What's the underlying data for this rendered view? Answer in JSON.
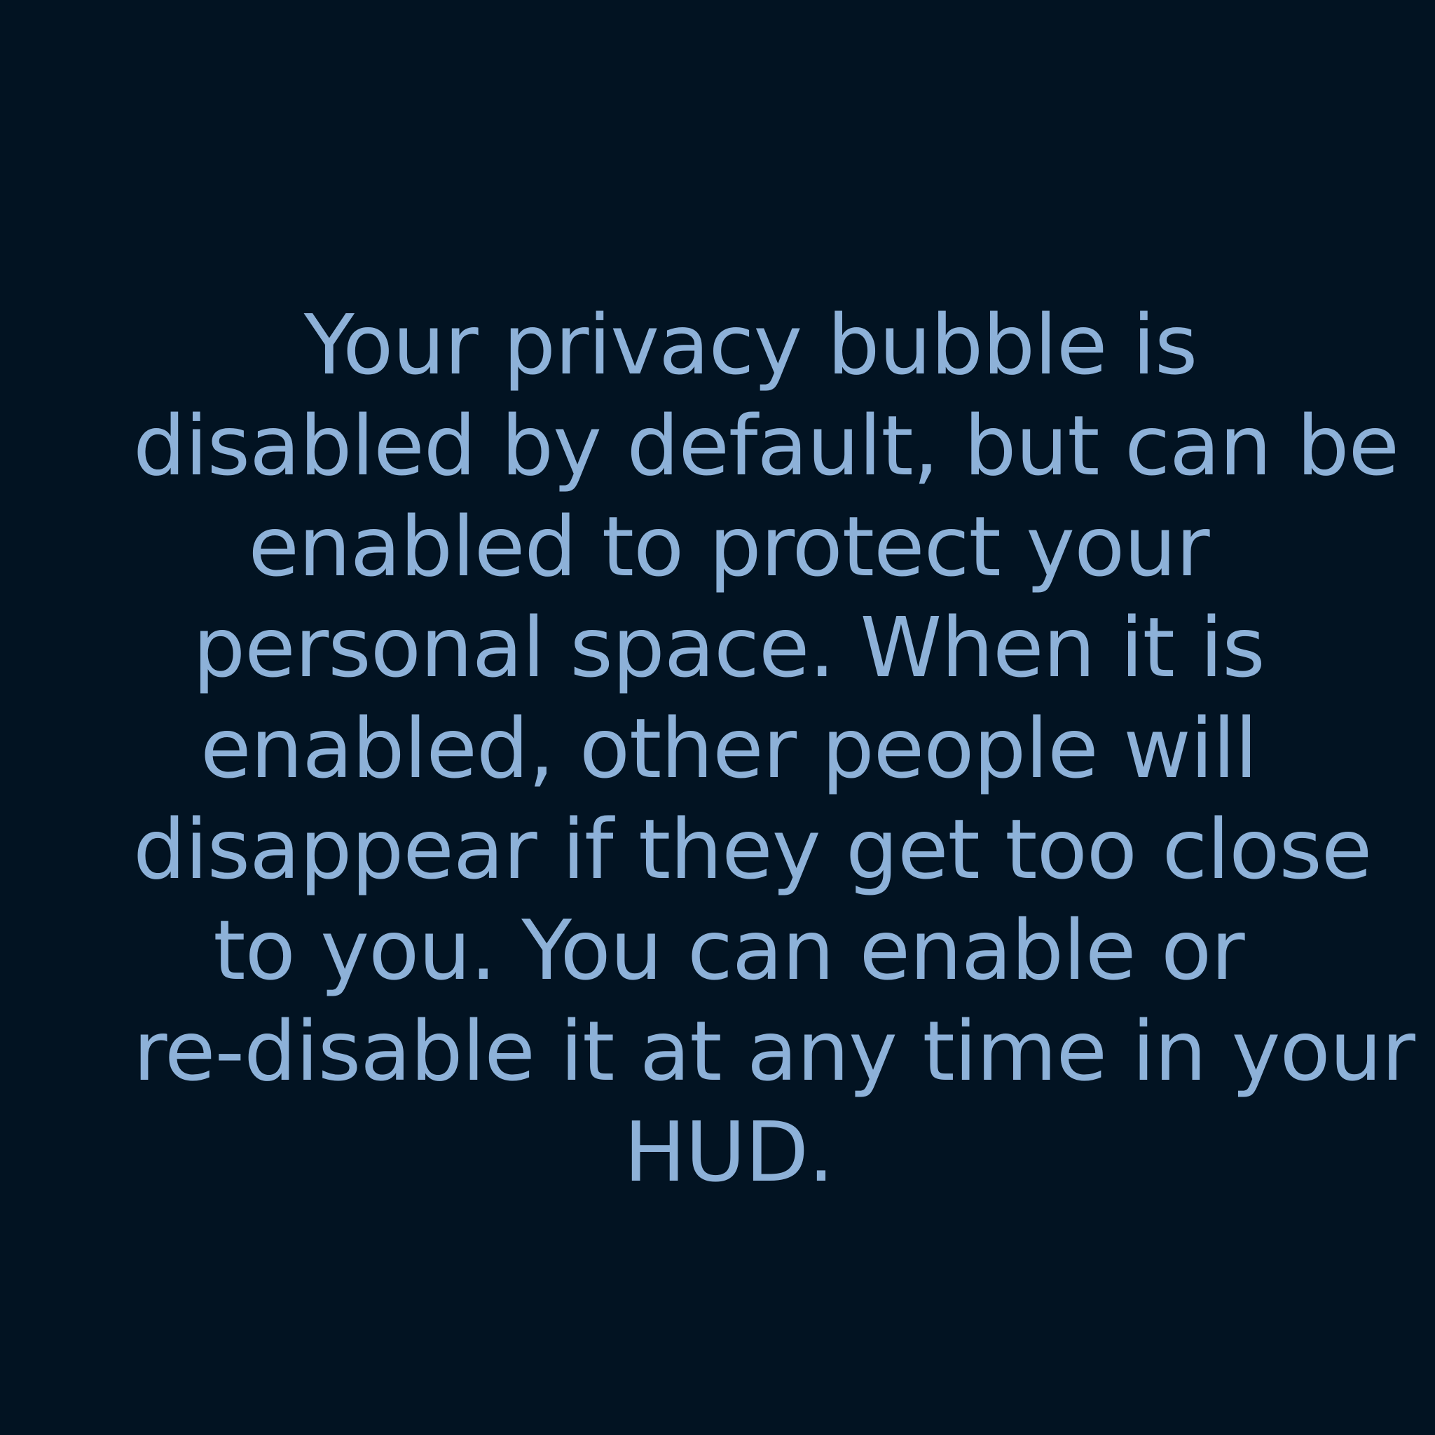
{
  "colors": {
    "background": "#021322",
    "text": "#8db1d8"
  },
  "message": {
    "lines": [
      "Your privacy bubble is",
      "disabled by default, but can be",
      "enabled to protect your",
      "personal space. When it is",
      "enabled, other people will",
      "disappear if they get too close",
      "to you. You can enable or",
      "re-disable it at any time in your",
      "HUD."
    ]
  }
}
